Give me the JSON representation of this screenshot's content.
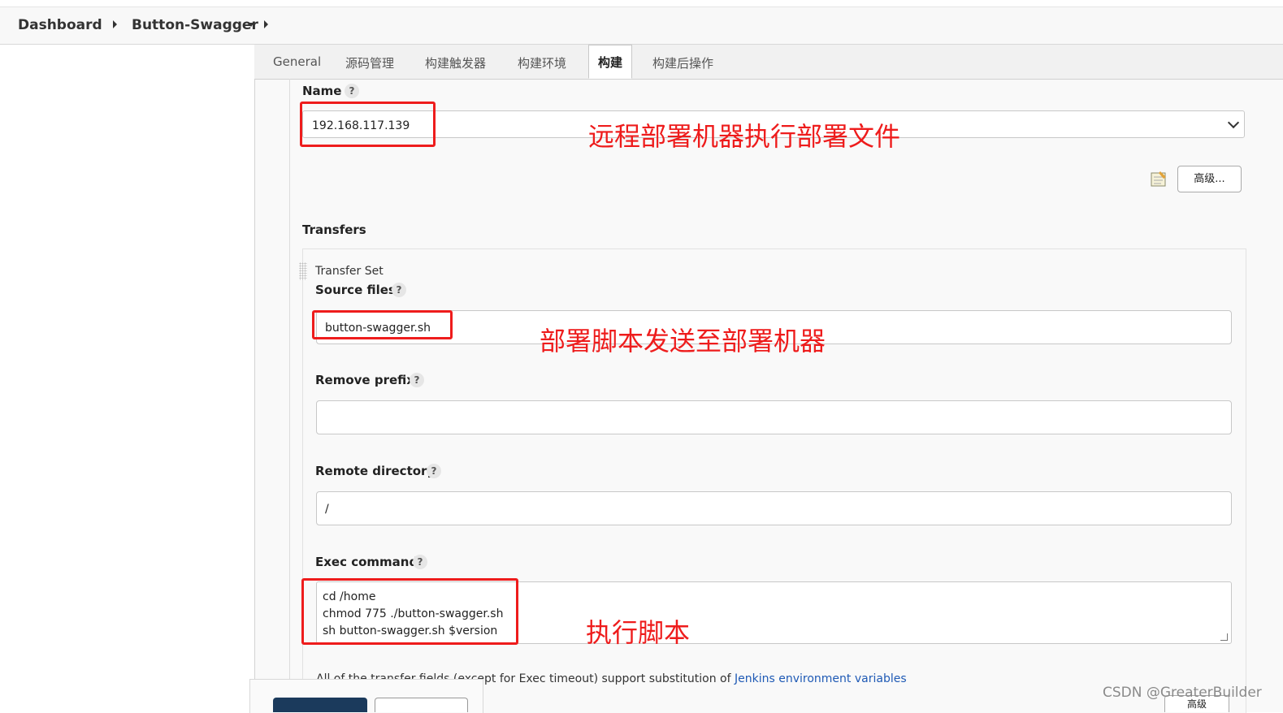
{
  "breadcrumb": {
    "dashboard": "Dashboard",
    "project": "Button-Swagger"
  },
  "tabs": [
    "General",
    "源码管理",
    "构建触发器",
    "构建环境",
    "构建",
    "构建后操作"
  ],
  "active_tab": "构建",
  "server": {
    "label": "Name",
    "help": "?",
    "value": "192.168.117.139"
  },
  "advanced_label": "高级...",
  "transfers": {
    "heading": "Transfers",
    "set_label": "Transfer Set",
    "source_files": {
      "label": "Source files",
      "help": "?",
      "value": "button-swagger.sh"
    },
    "remove_prefix": {
      "label": "Remove prefix",
      "help": "?",
      "value": ""
    },
    "remote_directory": {
      "label": "Remote directory",
      "help": "?",
      "value": "/"
    },
    "exec_command": {
      "label": "Exec command",
      "help": "?",
      "lines": [
        "cd /home",
        "chmod 775 ./button-swagger.sh",
        "sh button-swagger.sh $version"
      ]
    },
    "note_prefix": "All of the transfer fields (except for Exec timeout) support substitution of ",
    "note_link": "Jenkins environment variables"
  },
  "annotations": {
    "remote_exec": "远程部署机器执行部署文件",
    "send_script": "部署脚本发送至部署机器",
    "exec_script": "执行脚本",
    "color": "#ee1c1c"
  },
  "bottom_advanced_label": "高级",
  "watermark": "CSDN @GreaterBuilder"
}
